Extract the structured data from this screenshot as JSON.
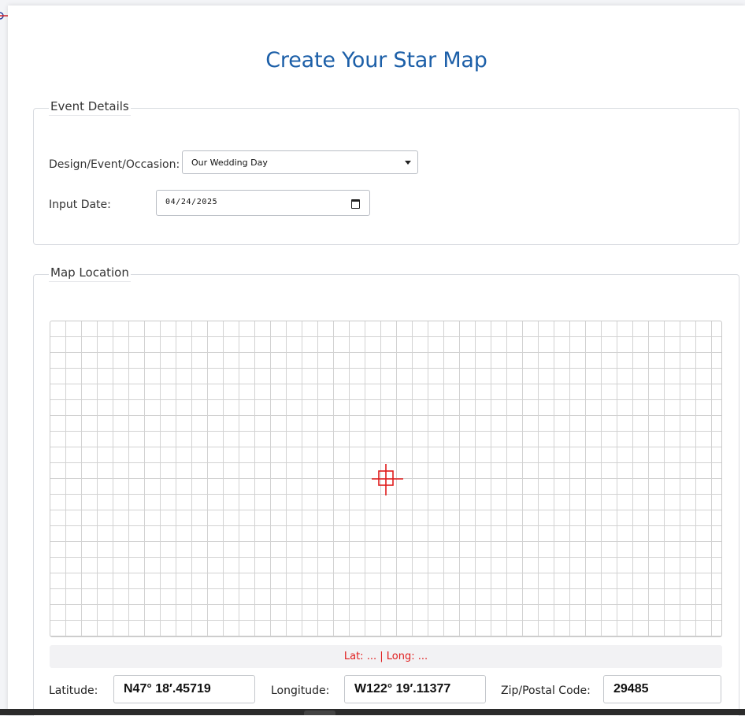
{
  "page": {
    "title": "Create Your Star Map"
  },
  "event_details": {
    "legend": "Event Details",
    "design_label": "Design/Event/Occasion:",
    "design_value": "Our Wedding Day",
    "date_label": "Input Date:",
    "date_value": "04/24/2025"
  },
  "map_location": {
    "legend": "Map Location",
    "readout": "Lat: ... | Long: ...",
    "latitude_label": "Latitude:",
    "latitude_value": "N47° 18′.45719",
    "longitude_label": "Longitude:",
    "longitude_value": "W122° 19′.11377",
    "zip_label": "Zip/Postal Code:",
    "zip_value": "29485"
  },
  "icons": {
    "crosshair": "crosshair-icon",
    "calendar": "calendar-icon",
    "dropdown": "chevron-down-icon",
    "corner": "flag-icon"
  },
  "colors": {
    "title": "#1c5fa8",
    "crosshair": "#e01c1c",
    "readout": "#e01c1c"
  }
}
